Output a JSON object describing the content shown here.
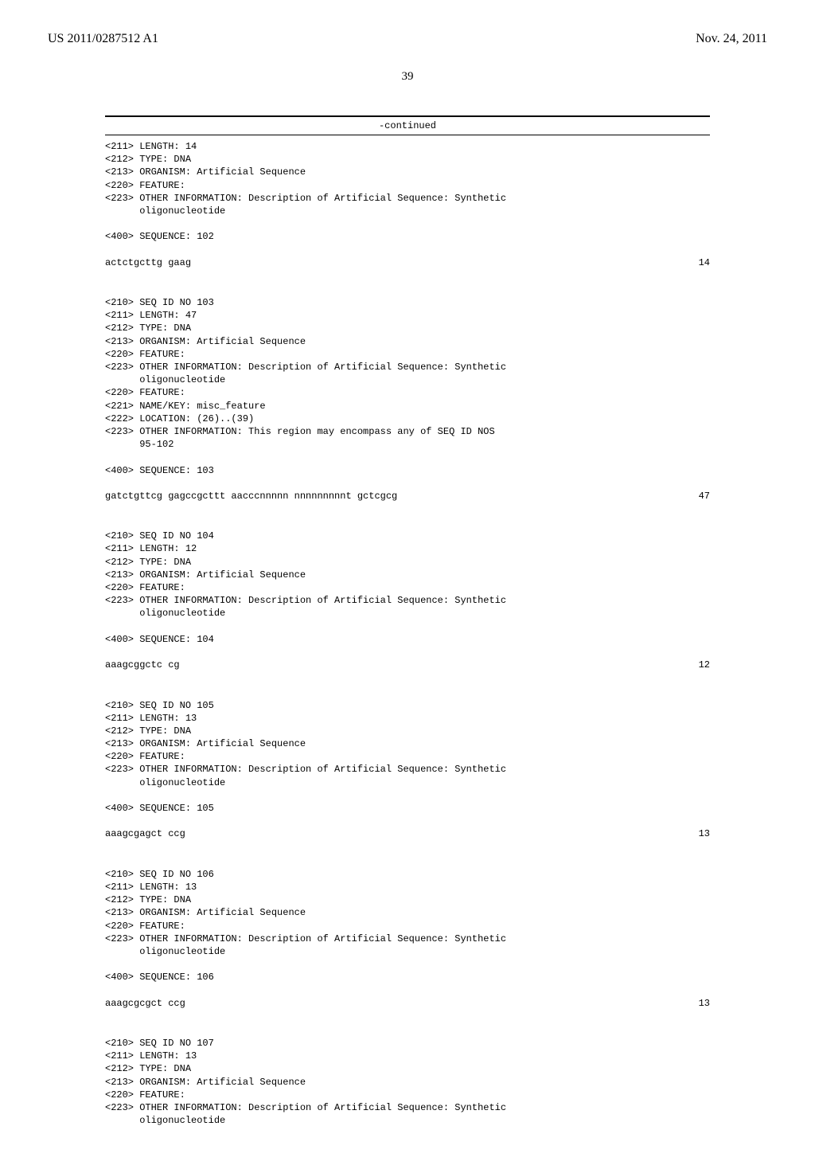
{
  "header": {
    "pub_number": "US 2011/0287512 A1",
    "pub_date": "Nov. 24, 2011"
  },
  "page_number": "39",
  "continued_label": "-continued",
  "entries": [
    {
      "meta": [
        "<211> LENGTH: 14",
        "<212> TYPE: DNA",
        "<213> ORGANISM: Artificial Sequence",
        "<220> FEATURE:",
        "<223> OTHER INFORMATION: Description of Artificial Sequence: Synthetic",
        "      oligonucleotide"
      ],
      "seq_label": "<400> SEQUENCE: 102",
      "seq_text": "actctgcttg gaag",
      "seq_len": "14"
    },
    {
      "meta": [
        "<210> SEQ ID NO 103",
        "<211> LENGTH: 47",
        "<212> TYPE: DNA",
        "<213> ORGANISM: Artificial Sequence",
        "<220> FEATURE:",
        "<223> OTHER INFORMATION: Description of Artificial Sequence: Synthetic",
        "      oligonucleotide",
        "<220> FEATURE:",
        "<221> NAME/KEY: misc_feature",
        "<222> LOCATION: (26)..(39)",
        "<223> OTHER INFORMATION: This region may encompass any of SEQ ID NOS",
        "      95-102"
      ],
      "seq_label": "<400> SEQUENCE: 103",
      "seq_text": "gatctgttcg gagccgcttt aacccnnnnn nnnnnnnnnt gctcgcg",
      "seq_len": "47"
    },
    {
      "meta": [
        "<210> SEQ ID NO 104",
        "<211> LENGTH: 12",
        "<212> TYPE: DNA",
        "<213> ORGANISM: Artificial Sequence",
        "<220> FEATURE:",
        "<223> OTHER INFORMATION: Description of Artificial Sequence: Synthetic",
        "      oligonucleotide"
      ],
      "seq_label": "<400> SEQUENCE: 104",
      "seq_text": "aaagcggctc cg",
      "seq_len": "12"
    },
    {
      "meta": [
        "<210> SEQ ID NO 105",
        "<211> LENGTH: 13",
        "<212> TYPE: DNA",
        "<213> ORGANISM: Artificial Sequence",
        "<220> FEATURE:",
        "<223> OTHER INFORMATION: Description of Artificial Sequence: Synthetic",
        "      oligonucleotide"
      ],
      "seq_label": "<400> SEQUENCE: 105",
      "seq_text": "aaagcgagct ccg",
      "seq_len": "13"
    },
    {
      "meta": [
        "<210> SEQ ID NO 106",
        "<211> LENGTH: 13",
        "<212> TYPE: DNA",
        "<213> ORGANISM: Artificial Sequence",
        "<220> FEATURE:",
        "<223> OTHER INFORMATION: Description of Artificial Sequence: Synthetic",
        "      oligonucleotide"
      ],
      "seq_label": "<400> SEQUENCE: 106",
      "seq_text": "aaagcgcgct ccg",
      "seq_len": "13"
    },
    {
      "meta": [
        "<210> SEQ ID NO 107",
        "<211> LENGTH: 13",
        "<212> TYPE: DNA",
        "<213> ORGANISM: Artificial Sequence",
        "<220> FEATURE:",
        "<223> OTHER INFORMATION: Description of Artificial Sequence: Synthetic",
        "      oligonucleotide"
      ],
      "seq_label": "",
      "seq_text": "",
      "seq_len": ""
    }
  ]
}
